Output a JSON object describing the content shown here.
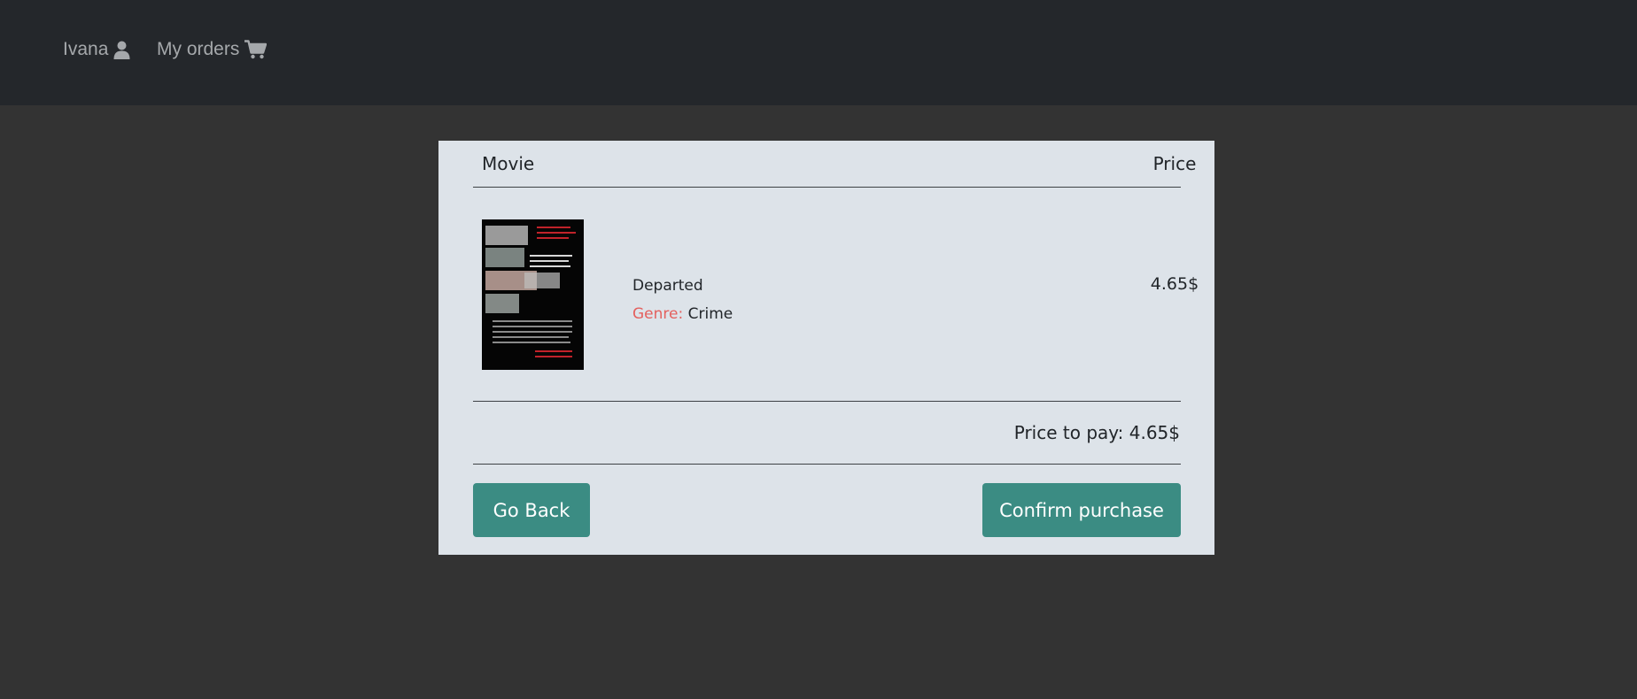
{
  "nav": {
    "user_label": "Ivana",
    "orders_label": "My orders"
  },
  "table": {
    "headers": {
      "movie": "Movie",
      "price": "Price"
    },
    "rows": [
      {
        "title": "Departed",
        "genre_label": "Genre:",
        "genre": "Crime",
        "price": "4.65$",
        "poster_text": "THE DEPARTED"
      }
    ]
  },
  "total": "Price to pay: 4.65$",
  "buttons": {
    "back": "Go Back",
    "confirm": "Confirm purchase"
  },
  "colors": {
    "navbar": "#24272b",
    "background": "#333333",
    "card": "#dde3e9",
    "button": "#3b8c83",
    "genre_label": "#e4605e"
  }
}
